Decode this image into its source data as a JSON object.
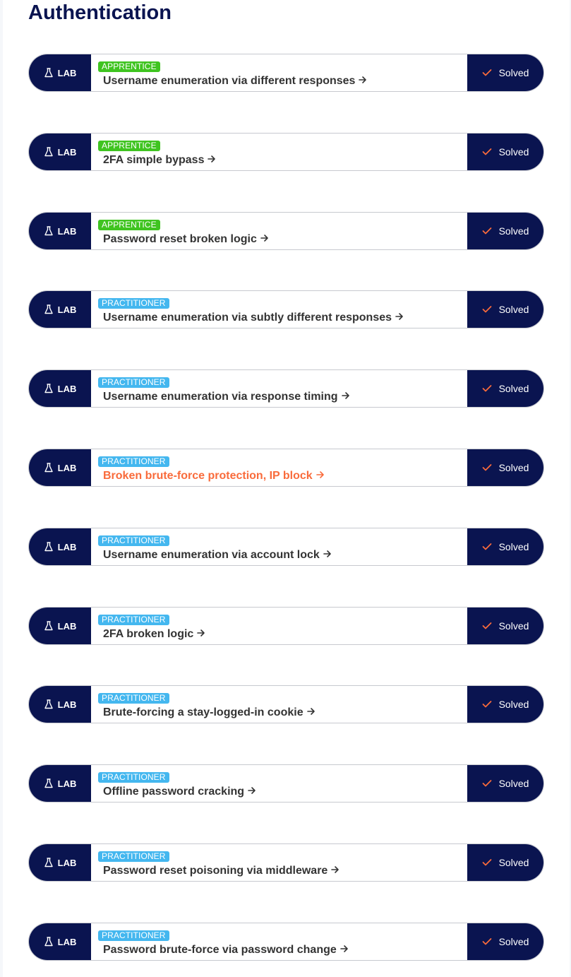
{
  "page": {
    "title": "Authentication"
  },
  "colors": {
    "navy": "#0a1450",
    "apprentice": "#3fc420",
    "practitioner": "#44b7ef",
    "accent": "#f96b3b"
  },
  "icons": {
    "lab": "flask-icon",
    "link": "arrow-right-icon",
    "status": "check-icon"
  },
  "labs": [
    {
      "tag": "LAB",
      "level": "APPRENTICE",
      "level_key": "apprentice",
      "title": "Username enumeration via different responses",
      "status": "Solved",
      "highlighted": false
    },
    {
      "tag": "LAB",
      "level": "APPRENTICE",
      "level_key": "apprentice",
      "title": "2FA simple bypass",
      "status": "Solved",
      "highlighted": false
    },
    {
      "tag": "LAB",
      "level": "APPRENTICE",
      "level_key": "apprentice",
      "title": "Password reset broken logic",
      "status": "Solved",
      "highlighted": false
    },
    {
      "tag": "LAB",
      "level": "PRACTITIONER",
      "level_key": "practitioner",
      "title": "Username enumeration via subtly different responses",
      "status": "Solved",
      "highlighted": false
    },
    {
      "tag": "LAB",
      "level": "PRACTITIONER",
      "level_key": "practitioner",
      "title": "Username enumeration via response timing",
      "status": "Solved",
      "highlighted": false
    },
    {
      "tag": "LAB",
      "level": "PRACTITIONER",
      "level_key": "practitioner",
      "title": "Broken brute-force protection, IP block",
      "status": "Solved",
      "highlighted": true
    },
    {
      "tag": "LAB",
      "level": "PRACTITIONER",
      "level_key": "practitioner",
      "title": "Username enumeration via account lock",
      "status": "Solved",
      "highlighted": false
    },
    {
      "tag": "LAB",
      "level": "PRACTITIONER",
      "level_key": "practitioner",
      "title": "2FA broken logic",
      "status": "Solved",
      "highlighted": false
    },
    {
      "tag": "LAB",
      "level": "PRACTITIONER",
      "level_key": "practitioner",
      "title": "Brute-forcing a stay-logged-in cookie",
      "status": "Solved",
      "highlighted": false
    },
    {
      "tag": "LAB",
      "level": "PRACTITIONER",
      "level_key": "practitioner",
      "title": "Offline password cracking",
      "status": "Solved",
      "highlighted": false
    },
    {
      "tag": "LAB",
      "level": "PRACTITIONER",
      "level_key": "practitioner",
      "title": "Password reset poisoning via middleware",
      "status": "Solved",
      "highlighted": false
    },
    {
      "tag": "LAB",
      "level": "PRACTITIONER",
      "level_key": "practitioner",
      "title": "Password brute-force via password change",
      "status": "Solved",
      "highlighted": false
    }
  ]
}
